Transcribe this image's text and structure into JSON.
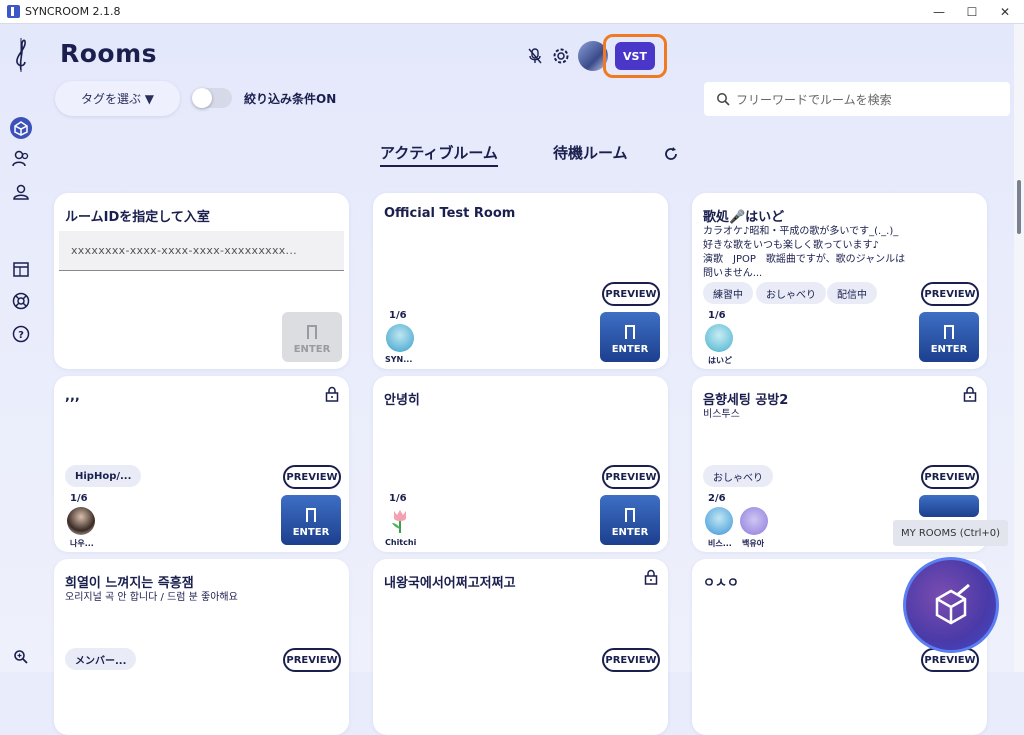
{
  "window": {
    "title": "SYNCROOM 2.1.8",
    "minimize": "—",
    "maximize": "☐",
    "close": "✕"
  },
  "header": {
    "title": "Rooms",
    "tag_button": "タグを選ぶ ▼",
    "filter_label": "絞り込み条件ON",
    "search_placeholder": "フリーワードでルームを検索",
    "vst_label": "VST"
  },
  "tabs": [
    {
      "label": "アクティブルーム"
    },
    {
      "label": "待機ルーム"
    }
  ],
  "cards": {
    "c1": {
      "title": "ルームIDを指定して入室",
      "input_placeholder": "xxxxxxxx-xxxx-xxxx-xxxx-xxxxxxxxx...",
      "enter": "ENTER"
    },
    "c2": {
      "title": "Official Test Room",
      "preview": "PREVIEW",
      "enter": "ENTER",
      "count": "1/6",
      "users": [
        "SYN..."
      ]
    },
    "c3": {
      "title": "歌処🎤はいど",
      "desc": [
        "カラオケ♪昭和・平成の歌が多いです_(._.)_",
        "好きな歌をいつも楽しく歌っています♪",
        "演歌　JPOP　歌謡曲ですが、歌のジャンルは",
        "問いません..."
      ],
      "tags": [
        "練習中",
        "おしゃべり",
        "配信中"
      ],
      "preview": "PREVIEW",
      "enter": "ENTER",
      "count": "1/6",
      "users": [
        "はいど"
      ]
    },
    "c4": {
      "title": ",,,",
      "tags": [
        "HipHop/..."
      ],
      "preview": "PREVIEW",
      "enter": "ENTER",
      "count": "1/6",
      "users": [
        "나우..."
      ]
    },
    "c5": {
      "title": "안녕히",
      "preview": "PREVIEW",
      "enter": "ENTER",
      "count": "1/6",
      "users": [
        "Chitchi"
      ]
    },
    "c6": {
      "title": "음향세팅 공방2",
      "subtitle": "비스투스",
      "tags": [
        "おしゃべり"
      ],
      "preview": "PREVIEW",
      "count": "2/6",
      "users": [
        "비스...",
        "백유아"
      ]
    },
    "c7": {
      "title": "희열이 느껴지는 즉흥잼",
      "subtitle": "오리지널 곡 안 합니다 / 드럼 분 좋아해요",
      "tags": [
        "メンバー..."
      ],
      "preview": "PREVIEW"
    },
    "c8": {
      "title": "내왕국에서어쩌고저쩌고",
      "preview": "PREVIEW"
    },
    "c9": {
      "title": "ㅇㅅㅇ",
      "preview": "PREVIEW"
    }
  },
  "my_rooms_tooltip": "MY ROOMS (Ctrl+0)",
  "colors": {
    "accent": "#4a37c9",
    "highlight": "#f07a22",
    "enter": "#2d58ad",
    "text": "#1a1f4e"
  }
}
